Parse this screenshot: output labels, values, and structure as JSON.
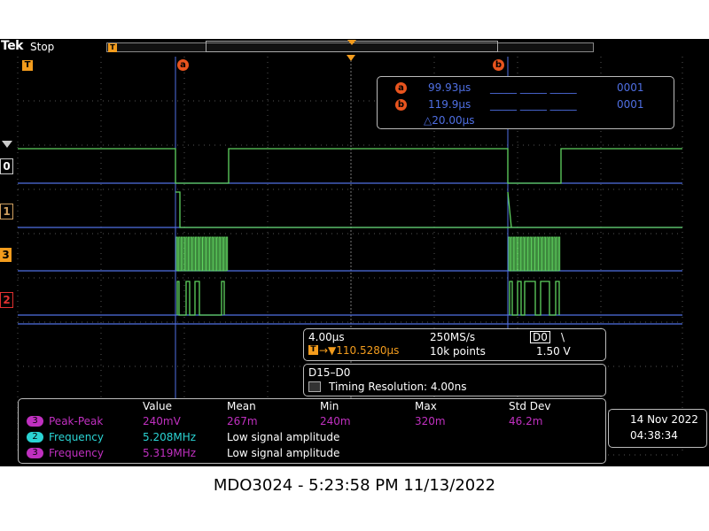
{
  "topbar": {
    "brand": "Tek",
    "status": "Stop"
  },
  "cursors": {
    "a_label": "a",
    "b_label": "b",
    "a_time": "99.93µs",
    "b_time": "119.9µs",
    "delta": "△20.00µs",
    "a_values": "_____ _____ _____",
    "b_values": "_____ _____ _____",
    "a_bits": "0001",
    "b_bits": "0001"
  },
  "horizontal": {
    "scale": "4.00µs",
    "sample_rate": "250MS/s",
    "trigger_label": "D0",
    "trigger_slope": "\\",
    "trigger_pos": "→▼110.5280µs",
    "record": "10k points",
    "level": "1.50 V"
  },
  "digital": {
    "bus": "D15–D0",
    "resolution": "Timing Resolution: 4.00ns"
  },
  "measurements": {
    "headers": [
      "Value",
      "Mean",
      "Min",
      "Max",
      "Std Dev"
    ],
    "rows": [
      {
        "ch": "3",
        "name": "Peak-Peak",
        "value": "240mV",
        "mean": "267m",
        "min": "240m",
        "max": "320m",
        "std": "46.2m",
        "color": "#c030c0"
      },
      {
        "ch": "2",
        "name": "Frequency",
        "value": "5.208MHz",
        "mean": "Low signal amplitude",
        "color": "#2ad4d4"
      },
      {
        "ch": "3",
        "name": "Frequency",
        "value": "5.319MHz",
        "mean": "Low signal amplitude",
        "color": "#c030c0"
      }
    ]
  },
  "datetime": {
    "date": "14 Nov 2022",
    "time": "04:38:34"
  },
  "channel_labels": [
    "0",
    "1",
    "3",
    "2"
  ],
  "caption": "MDO3024 - 5:23:58 PM    11/13/2022",
  "colors": {
    "trace_green": "#5fd35f",
    "baseline_blue": "#4f6fe3",
    "trigger_orange": "#f39c1d",
    "cursor_orange": "#e8541e",
    "ch3_purple": "#c030c0",
    "ch2_cyan": "#2ad4d4"
  }
}
